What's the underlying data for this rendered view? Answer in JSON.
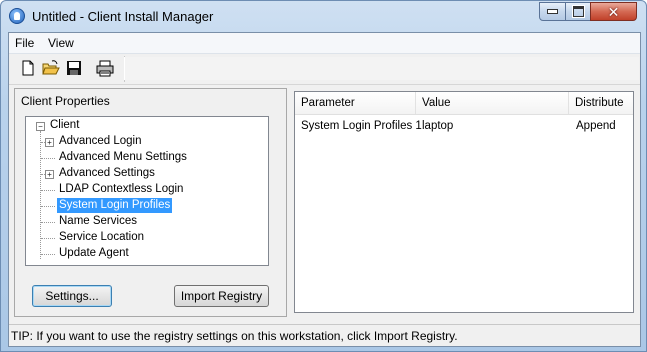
{
  "window": {
    "title": "Untitled - Client Install Manager"
  },
  "menu": {
    "items": [
      "File",
      "View"
    ]
  },
  "toolbar": {
    "buttons": [
      "new-document-icon",
      "open-folder-icon",
      "save-icon",
      "print-icon"
    ]
  },
  "client_properties": {
    "label": "Client Properties",
    "tree": {
      "root": "Client",
      "children": [
        {
          "label": "Advanced Login",
          "expandable": true
        },
        {
          "label": "Advanced Menu Settings",
          "expandable": false
        },
        {
          "label": "Advanced Settings",
          "expandable": true
        },
        {
          "label": "LDAP Contextless Login",
          "expandable": false
        },
        {
          "label": "System Login Profiles",
          "expandable": false,
          "selected": true
        },
        {
          "label": "Name Services",
          "expandable": false
        },
        {
          "label": "Service Location",
          "expandable": false
        },
        {
          "label": "Update Agent",
          "expandable": false
        }
      ]
    },
    "settings_button": "Settings...",
    "import_button": "Import Registry"
  },
  "list": {
    "columns": [
      "Parameter",
      "Value",
      "Distribute"
    ],
    "rows": [
      {
        "parameter": "System Login Profiles 1",
        "value": "laptop",
        "distribute": "Append"
      }
    ]
  },
  "status": {
    "tip": "TIP: If you want to use the registry settings on this workstation, click Import Registry."
  },
  "colors": {
    "selection": "#3399ff",
    "titlebar": "#b9d2ec",
    "close_button": "#c0412a"
  }
}
